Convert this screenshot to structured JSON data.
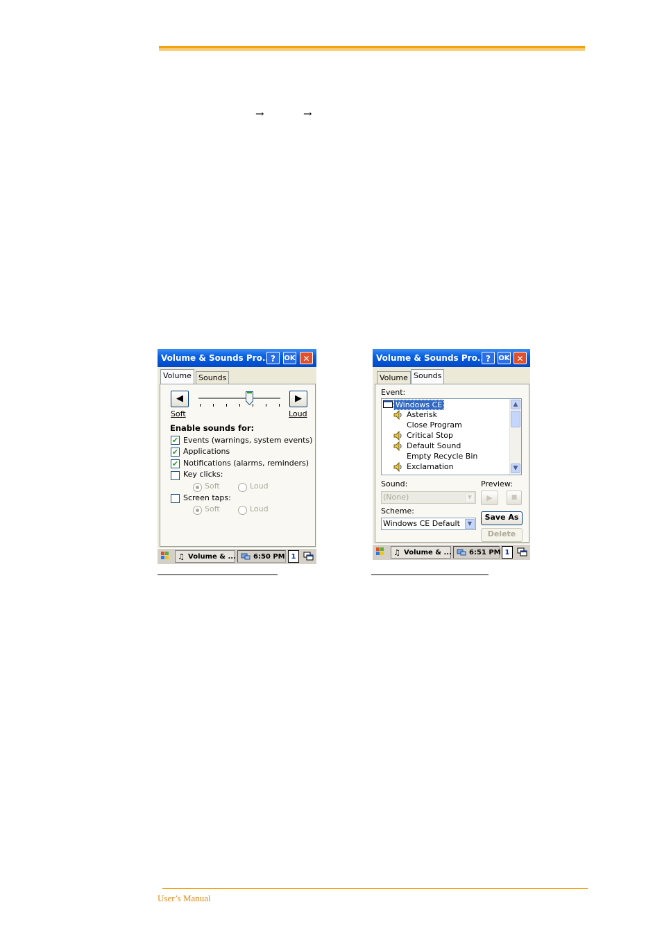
{
  "page": {
    "breadcrumb_arrow": "→",
    "footer": "User’s Manual"
  },
  "colors": {
    "accent": "#f2a20f",
    "titlebar": "#0a5fe0",
    "window_bg": "#ece9d8"
  },
  "volume_window": {
    "title": "Volume & Sounds Pro...",
    "help_label": "?",
    "ok_label": "OK",
    "close_label": "✕",
    "tabs": [
      "Volume",
      "Sounds"
    ],
    "active_tab": "Volume",
    "soft_label": "Soft",
    "loud_label": "Loud",
    "left_arrow": "◀",
    "right_arrow": "▶",
    "volume_level_fraction": 0.62,
    "enable_label": "Enable sounds for:",
    "options": [
      {
        "label": "Events (warnings, system events)",
        "checked": true
      },
      {
        "label": "Applications",
        "checked": true
      },
      {
        "label": "Notifications (alarms, reminders)",
        "checked": true
      },
      {
        "label": "Key clicks:",
        "checked": false
      },
      {
        "label": "Screen taps:",
        "checked": false
      }
    ],
    "key_clicks_soft": "Soft",
    "key_clicks_loud": "Loud",
    "screen_taps_soft": "Soft",
    "screen_taps_loud": "Loud",
    "taskbar": {
      "task": "Volume & ...",
      "clock": "6:50 PM",
      "keyboard": "1"
    }
  },
  "sounds_window": {
    "title": "Volume & Sounds Pro...",
    "help_label": "?",
    "ok_label": "OK",
    "close_label": "✕",
    "tabs": [
      "Volume",
      "Sounds"
    ],
    "active_tab": "Sounds",
    "event_label": "Event:",
    "events": [
      {
        "label": "Windows CE",
        "sound": false,
        "selected": true
      },
      {
        "label": "Asterisk",
        "sound": true
      },
      {
        "label": "Close Program",
        "sound": false
      },
      {
        "label": "Critical Stop",
        "sound": true
      },
      {
        "label": "Default Sound",
        "sound": true
      },
      {
        "label": "Empty Recycle Bin",
        "sound": false
      },
      {
        "label": "Exclamation",
        "sound": true
      }
    ],
    "sound_label": "Sound:",
    "sound_value": "(None)",
    "preview_label": "Preview:",
    "scheme_label": "Scheme:",
    "scheme_value": "Windows CE Default",
    "save_as_label": "Save As",
    "delete_label": "Delete",
    "taskbar": {
      "task": "Volume & ...",
      "clock": "6:51 PM",
      "keyboard": "1"
    }
  }
}
